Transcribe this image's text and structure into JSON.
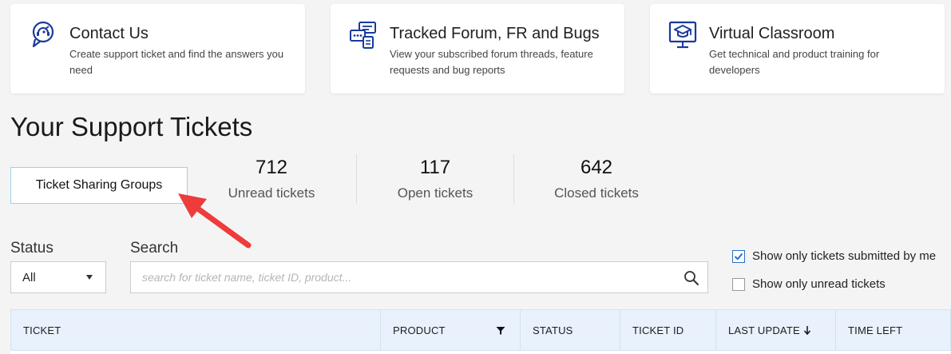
{
  "cards": [
    {
      "title": "Contact Us",
      "desc": "Create support ticket and find the answers you need",
      "icon": "headset-chat-icon"
    },
    {
      "title": "Tracked Forum, FR and Bugs",
      "desc": "View your subscribed forum threads, feature requests and bug reports",
      "icon": "forum-threads-icon"
    },
    {
      "title": "Virtual Classroom",
      "desc": "Get technical and product training for developers",
      "icon": "graduation-screen-icon"
    }
  ],
  "page_title": "Your Support Tickets",
  "ticket_sharing_button": "Ticket Sharing Groups",
  "stats": [
    {
      "value": "712",
      "label": "Unread tickets"
    },
    {
      "value": "117",
      "label": "Open tickets"
    },
    {
      "value": "642",
      "label": "Closed tickets"
    }
  ],
  "filters": {
    "status_label": "Status",
    "status_value": "All",
    "search_label": "Search",
    "search_placeholder": "search for ticket name, ticket ID, product...",
    "search_value": ""
  },
  "checkboxes": [
    {
      "label": "Show only tickets submitted by me",
      "checked": true
    },
    {
      "label": "Show only unread tickets",
      "checked": false
    }
  ],
  "table": {
    "columns": [
      "TICKET",
      "PRODUCT",
      "STATUS",
      "TICKET ID",
      "LAST UPDATE",
      "TIME LEFT"
    ]
  },
  "colors": {
    "accent": "#1a3a9c",
    "arrow": "#ee3b3b",
    "check": "#2a6ec8",
    "table_header_bg": "#e8f1fc"
  }
}
